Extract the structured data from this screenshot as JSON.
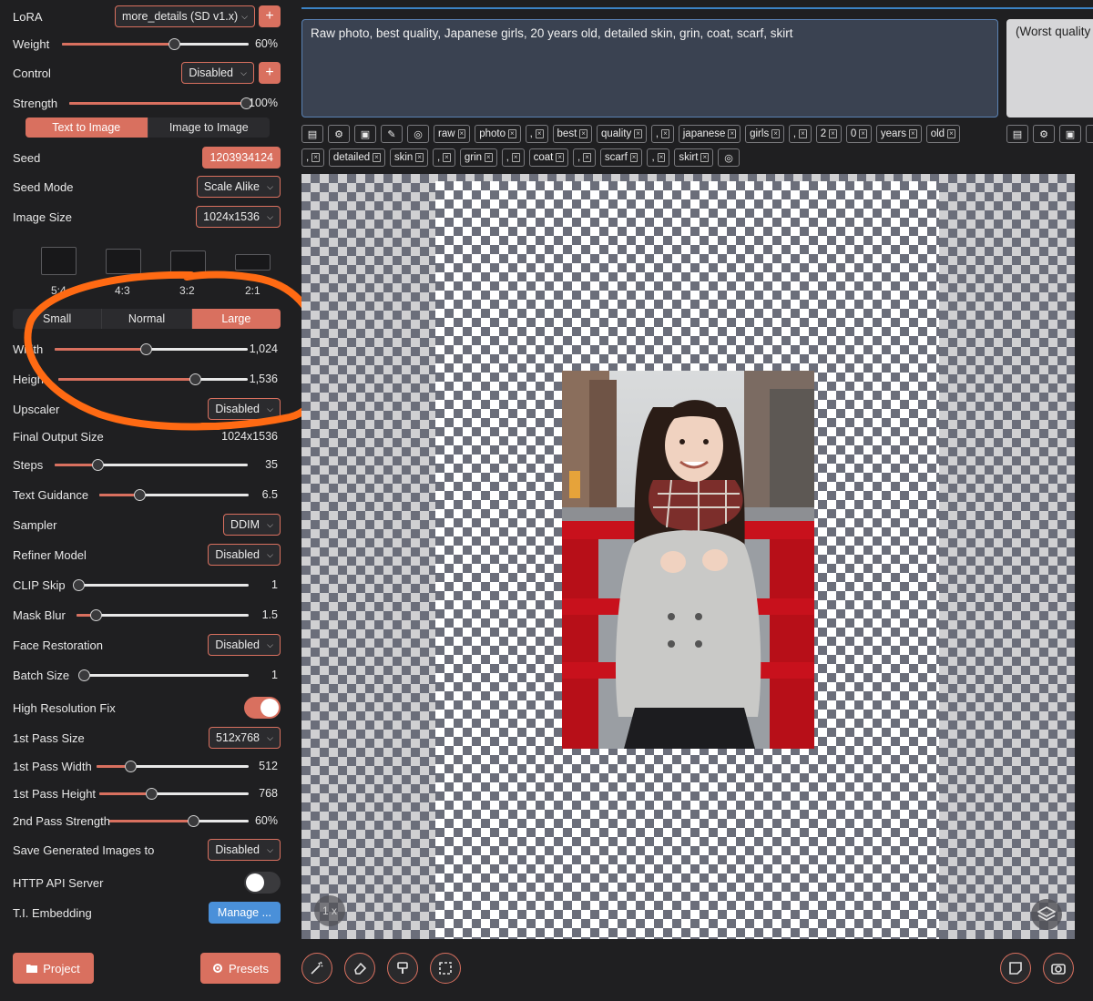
{
  "sidebar": {
    "lora_label": "LoRA",
    "lora_value": "more_details (SD v1.x)",
    "weight": {
      "label": "Weight",
      "value": "60%",
      "fraction": 0.6
    },
    "control": {
      "label": "Control",
      "value": "Disabled"
    },
    "strength": {
      "label": "Strength",
      "value": "100%",
      "fraction": 1.0
    },
    "mode_tabs": [
      {
        "label": "Text to Image",
        "active": true
      },
      {
        "label": "Image to Image",
        "active": false
      }
    ],
    "seed": {
      "label": "Seed",
      "value": "1203934124"
    },
    "seed_mode": {
      "label": "Seed Mode",
      "value": "Scale Alike"
    },
    "image_size": {
      "label": "Image Size",
      "value": "1024x1536"
    },
    "ratios": [
      "5:4",
      "4:3",
      "3:2",
      "2:1"
    ],
    "size_tabs": [
      {
        "label": "Small",
        "active": false
      },
      {
        "label": "Normal",
        "active": false
      },
      {
        "label": "Large",
        "active": true
      }
    ],
    "width": {
      "label": "Width",
      "value": "1,024",
      "fraction": 0.47
    },
    "height": {
      "label": "Height",
      "value": "1,536",
      "fraction": 0.72
    },
    "upscaler": {
      "label": "Upscaler",
      "value": "Disabled"
    },
    "final_output": {
      "label": "Final Output Size",
      "value": "1024x1536"
    },
    "steps": {
      "label": "Steps",
      "value": "35",
      "fraction": 0.22
    },
    "text_guidance": {
      "label": "Text Guidance",
      "value": "6.5",
      "fraction": 0.27
    },
    "sampler": {
      "label": "Sampler",
      "value": "DDIM"
    },
    "refiner": {
      "label": "Refiner Model",
      "value": "Disabled"
    },
    "clip_skip": {
      "label": "CLIP Skip",
      "value": "1",
      "fraction": 0.0
    },
    "mask_blur": {
      "label": "Mask Blur",
      "value": "1.5",
      "fraction": 0.11
    },
    "face_restoration": {
      "label": "Face Restoration",
      "value": "Disabled"
    },
    "batch_size": {
      "label": "Batch Size",
      "value": "1",
      "fraction": 0.0
    },
    "hires_fix": {
      "label": "High Resolution Fix",
      "on": true
    },
    "first_pass_size": {
      "label": "1st Pass Size",
      "value": "512x768"
    },
    "first_pass_width": {
      "label": "1st Pass Width",
      "value": "512",
      "fraction": 0.22
    },
    "first_pass_height": {
      "label": "1st Pass Height",
      "value": "768",
      "fraction": 0.35
    },
    "second_pass_strength": {
      "label": "2nd Pass Strength",
      "value": "60%",
      "fraction": 0.6
    },
    "save_images": {
      "label": "Save Generated Images to",
      "value": "Disabled"
    },
    "http_api": {
      "label": "HTTP API Server",
      "on": false
    },
    "ti_embedding": {
      "label": "T.I. Embedding",
      "value": "Manage ..."
    },
    "project_label": "Project",
    "presets_label": "Presets"
  },
  "prompt": {
    "text": "Raw photo, best quality, Japanese girls, 20 years old, detailed skin, grin, coat, scarf, skirt",
    "negative_text": "(Worst quality"
  },
  "tokens_row1": [
    "raw",
    "photo",
    ",",
    "best",
    "quality",
    ",",
    "japanese",
    "girls",
    ",",
    "2",
    "0",
    "years",
    "old"
  ],
  "tokens_row2": [
    ",",
    "detailed",
    "skin",
    ",",
    "grin",
    ",",
    "coat",
    ",",
    "scarf",
    ",",
    "skirt"
  ],
  "canvas": {
    "zoom_label": "1 x"
  },
  "colors": {
    "accent": "#d9705f",
    "annotation": "#ff6a13",
    "link": "#3b82c4",
    "manage_button": "#4a90d9"
  }
}
